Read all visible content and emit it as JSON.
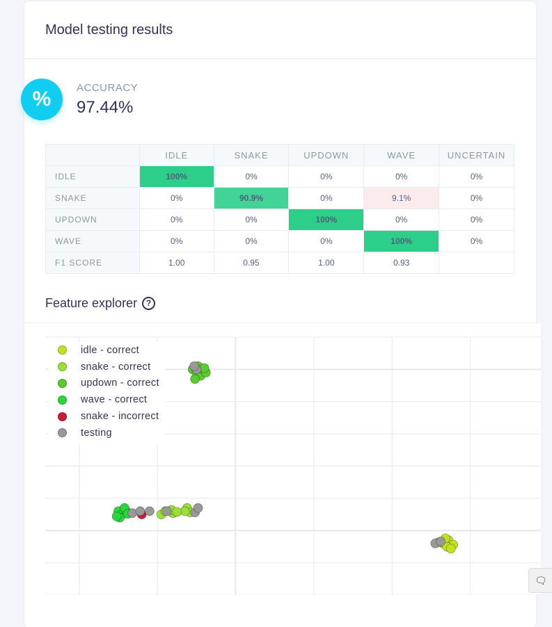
{
  "card": {
    "title": "Model testing results"
  },
  "accuracy": {
    "icon": "percent-icon",
    "icon_glyph": "%",
    "label": "ACCURACY",
    "value": "97.44%"
  },
  "confusion_matrix": {
    "columns": [
      "IDLE",
      "SNAKE",
      "UPDOWN",
      "WAVE",
      "UNCERTAIN"
    ],
    "rows": [
      {
        "label": "IDLE",
        "cells": [
          "100%",
          "0%",
          "0%",
          "0%",
          "0%"
        ]
      },
      {
        "label": "SNAKE",
        "cells": [
          "0%",
          "90.9%",
          "0%",
          "9.1%",
          "0%"
        ]
      },
      {
        "label": "UPDOWN",
        "cells": [
          "0%",
          "0%",
          "100%",
          "0%",
          "0%"
        ]
      },
      {
        "label": "WAVE",
        "cells": [
          "0%",
          "0%",
          "0%",
          "100%",
          "0%"
        ]
      }
    ],
    "f1": {
      "label": "F1 SCORE",
      "cells": [
        "1.00",
        "0.95",
        "1.00",
        "0.93",
        ""
      ]
    }
  },
  "feature_explorer": {
    "title": "Feature explorer",
    "help_icon": "help-circle-icon",
    "legend": [
      {
        "label": "idle - correct",
        "color": "#c4e022"
      },
      {
        "label": "snake - correct",
        "color": "#9be03a"
      },
      {
        "label": "updown - correct",
        "color": "#5acb2d"
      },
      {
        "label": "wave - correct",
        "color": "#28d83c"
      },
      {
        "label": "snake - incorrect",
        "color": "#d01a3a"
      },
      {
        "label": "testing",
        "color": "#999999"
      }
    ]
  },
  "chart_data": {
    "type": "scatter",
    "series": [
      {
        "name": "idle - correct",
        "color": "#c4e022",
        "points": [
          [
            4.65,
            -0.2
          ],
          [
            4.72,
            -0.15
          ],
          [
            4.6,
            -0.18
          ],
          [
            4.78,
            -0.22
          ],
          [
            4.7,
            -0.25
          ],
          [
            4.68,
            -0.12
          ],
          [
            4.75,
            -0.28
          ]
        ]
      },
      {
        "name": "snake - correct",
        "color": "#9be03a",
        "points": [
          [
            1.05,
            0.25
          ],
          [
            1.1,
            0.3
          ],
          [
            1.2,
            0.27
          ],
          [
            1.38,
            0.35
          ],
          [
            1.42,
            0.28
          ],
          [
            1.35,
            0.3
          ],
          [
            1.18,
            0.32
          ],
          [
            1.25,
            0.29
          ]
        ]
      },
      {
        "name": "updown - correct",
        "color": "#5acb2d",
        "points": [
          [
            1.45,
            2.5
          ],
          [
            1.5,
            2.45
          ],
          [
            1.55,
            2.4
          ],
          [
            1.58,
            2.5
          ],
          [
            1.62,
            2.45
          ],
          [
            1.48,
            2.35
          ],
          [
            1.52,
            2.55
          ],
          [
            1.6,
            2.52
          ]
        ]
      },
      {
        "name": "wave - correct",
        "color": "#28d83c",
        "points": [
          [
            0.5,
            0.3
          ],
          [
            0.55,
            0.25
          ],
          [
            0.6,
            0.3
          ],
          [
            0.52,
            0.2
          ],
          [
            0.58,
            0.35
          ],
          [
            0.48,
            0.22
          ],
          [
            0.62,
            0.26
          ]
        ]
      },
      {
        "name": "snake - incorrect",
        "color": "#d01a3a",
        "points": [
          [
            0.8,
            0.25
          ]
        ]
      },
      {
        "name": "testing",
        "color": "#999999",
        "points": [
          [
            0.68,
            0.27
          ],
          [
            0.78,
            0.3
          ],
          [
            0.9,
            0.3
          ],
          [
            1.12,
            0.3
          ],
          [
            1.48,
            0.28
          ],
          [
            1.52,
            0.35
          ],
          [
            1.5,
            2.5
          ],
          [
            1.47,
            2.55
          ],
          [
            4.55,
            -0.2
          ],
          [
            4.62,
            -0.17
          ]
        ]
      }
    ],
    "xlim": [
      -0.7,
      5.9
    ],
    "ylim": [
      -1.0,
      3.0
    ],
    "grid": true,
    "legend_position": "top-left"
  }
}
